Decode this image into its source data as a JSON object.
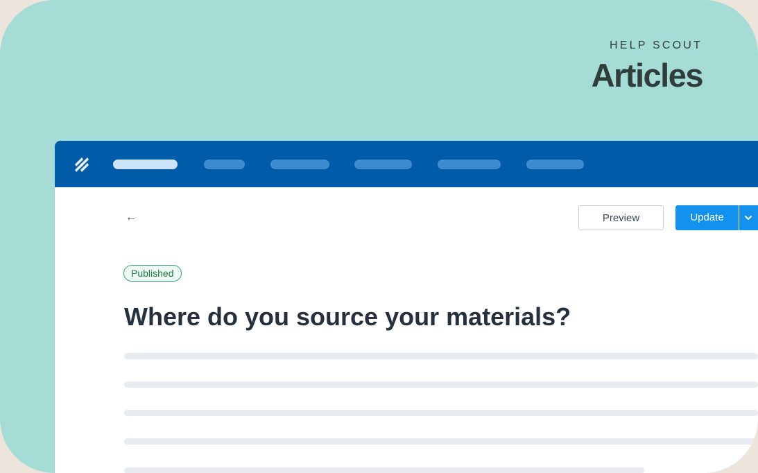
{
  "brand": {
    "subtitle": "HELP SCOUT",
    "title": "Articles"
  },
  "icons": {
    "logo": "help-scout-logo-icon",
    "back": "arrow-left-icon",
    "caret": "chevron-down-icon"
  },
  "colors": {
    "background": "#a5dcd6",
    "topbar": "#005ca8",
    "primary_button": "#1292ee",
    "published_badge": "#3aa66c"
  },
  "toolbar": {
    "back_glyph": "←",
    "preview_label": "Preview",
    "update_label": "Update"
  },
  "article": {
    "status": "Published",
    "title": "Where do you source your materials?"
  }
}
